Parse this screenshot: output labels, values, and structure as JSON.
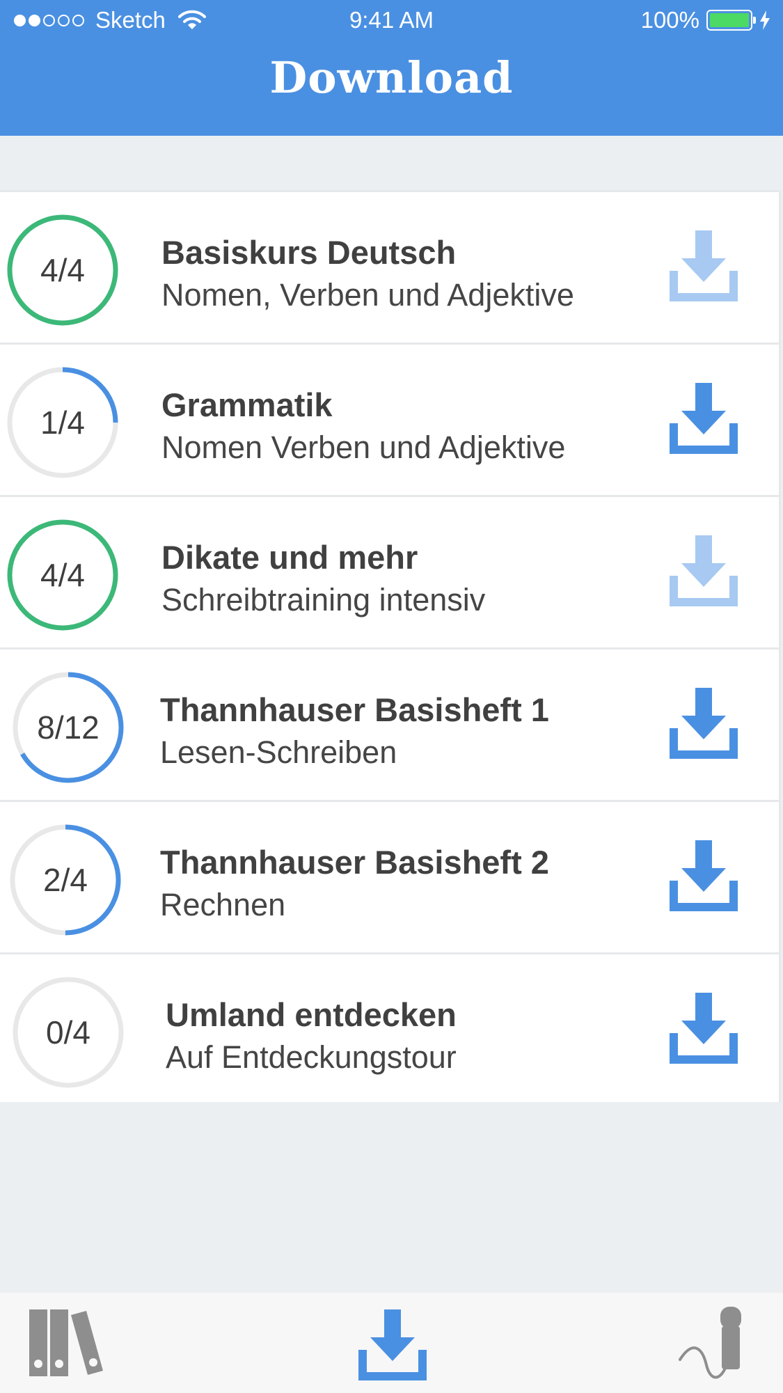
{
  "status_bar": {
    "carrier": "Sketch",
    "time": "9:41 AM",
    "battery": "100%",
    "signal_bars": 2,
    "signal_total": 5
  },
  "header": {
    "title": "Download"
  },
  "colors": {
    "brand": "#4a90e2",
    "complete": "#3cb878",
    "track": "#e8e8e8",
    "download_active": "#4a90e2",
    "download_done": "#a7c9f2"
  },
  "courses": [
    {
      "progress": "4/4",
      "fraction": 1.0,
      "title": "Basiskurs Deutsch",
      "subtitle": "Nomen, Verben und Adjektive",
      "downloaded": true
    },
    {
      "progress": "1/4",
      "fraction": 0.25,
      "title": "Grammatik",
      "subtitle": "Nomen Verben und Adjektive",
      "downloaded": false
    },
    {
      "progress": "4/4",
      "fraction": 1.0,
      "title": "Dikate und mehr",
      "subtitle": "Schreibtraining intensiv",
      "downloaded": true
    },
    {
      "progress": "8/12",
      "fraction": 0.6667,
      "title": "Thannhauser Basisheft 1",
      "subtitle": "Lesen-Schreiben",
      "downloaded": false
    },
    {
      "progress": "2/4",
      "fraction": 0.5,
      "title": "Thannhauser Basisheft 2",
      "subtitle": "Rechnen",
      "downloaded": false
    },
    {
      "progress": "0/4",
      "fraction": 0.0,
      "title": "Umland entdecken",
      "subtitle": "Auf Entdeckungstour",
      "downloaded": false
    }
  ],
  "tab_bar": {
    "tabs": [
      {
        "icon": "library-icon",
        "active": false
      },
      {
        "icon": "download-icon",
        "active": true
      },
      {
        "icon": "microphone-icon",
        "active": false
      }
    ]
  }
}
